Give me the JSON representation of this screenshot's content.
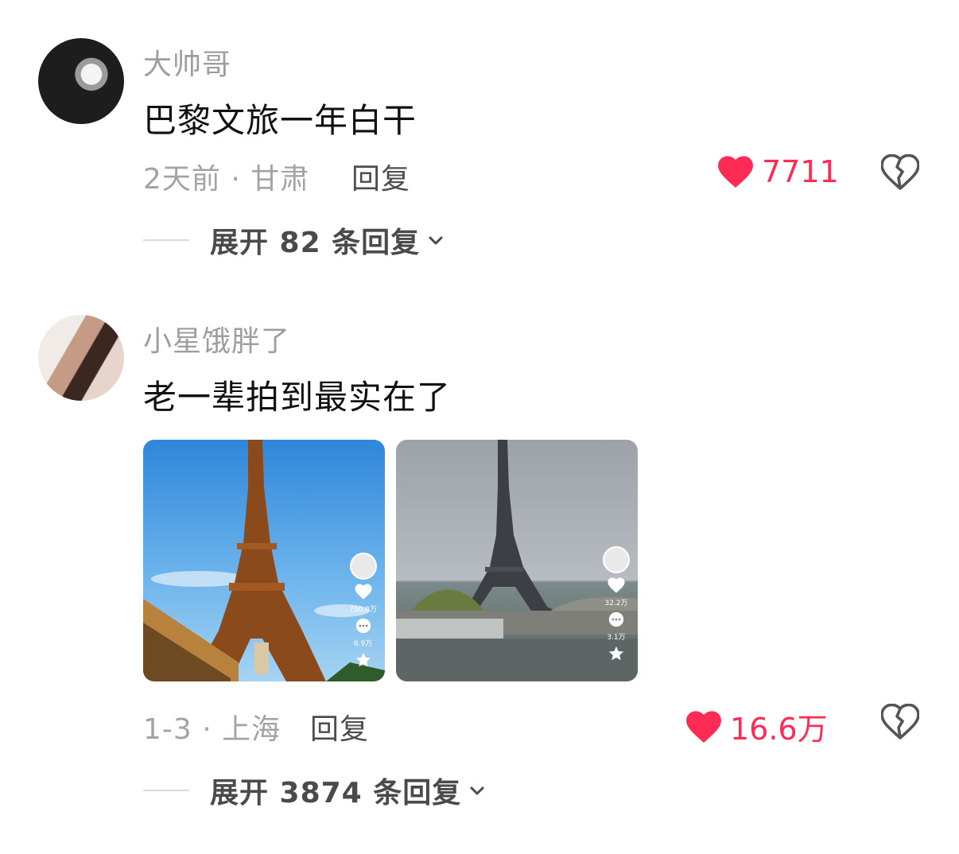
{
  "comments": [
    {
      "username": "大帅哥",
      "text": "巴黎文旅一年白干",
      "meta": "2天前 · 甘肃",
      "reply_label": "回复",
      "likes": "7711",
      "expand": "展开 82 条回复"
    },
    {
      "username": "小星饿胖了",
      "text": "老一辈拍到最实在了",
      "meta": "1-3 · 上海",
      "reply_label": "回复",
      "likes": "16.6万",
      "expand": "展开 3874 条回复",
      "images": [
        {
          "like_count": "750.0万",
          "comment_count": "6.9万"
        },
        {
          "like_count": "32.2万",
          "comment_count": "3.1万"
        }
      ]
    }
  ],
  "colors": {
    "like": "#fe2c55",
    "muted": "#a3a3a3",
    "text": "#111111"
  },
  "icons": [
    "heart-icon",
    "broken-heart-icon",
    "chevron-down-icon",
    "comment-icon",
    "star-icon"
  ]
}
